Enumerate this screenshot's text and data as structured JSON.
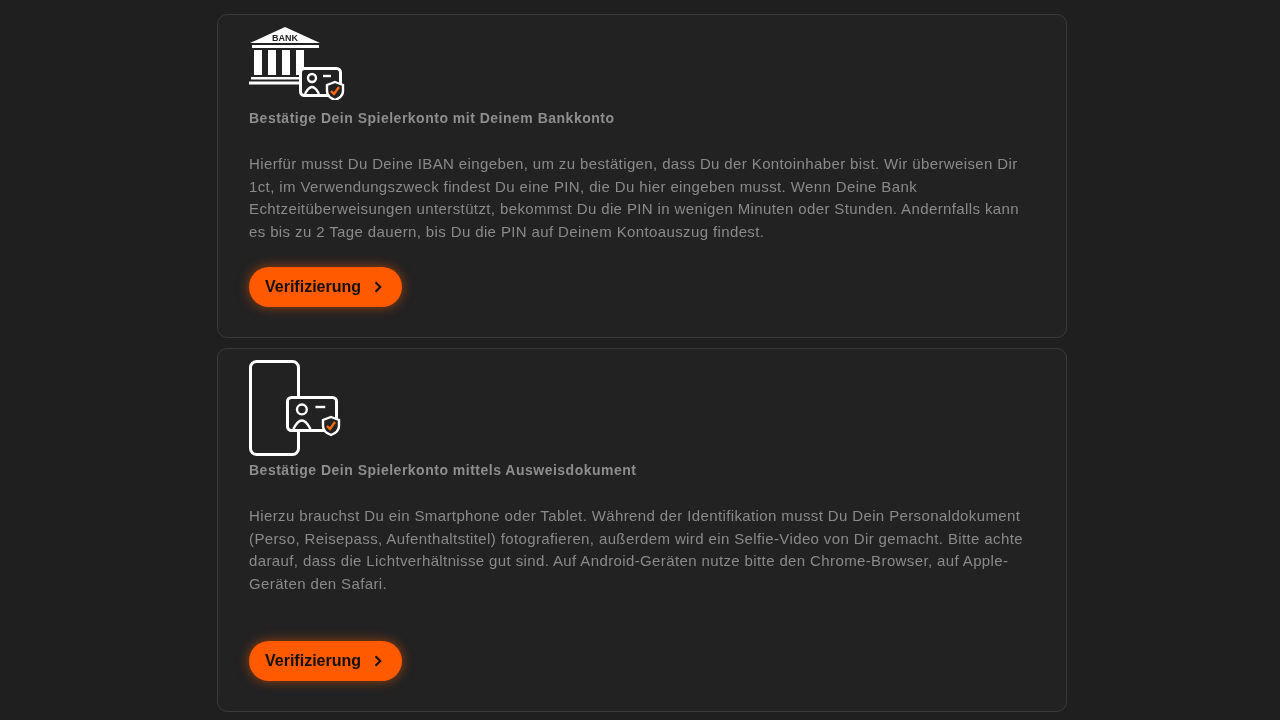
{
  "cards": [
    {
      "kind": "bank",
      "icon_label": "BANK",
      "title": "Bestätige Dein Spielerkonto mit Deinem Bankkonto",
      "description": "Hierfür musst Du Deine IBAN eingeben, um zu bestätigen, dass Du der Kontoinhaber bist. Wir überweisen Dir 1ct, im Verwendungszweck findest Du eine PIN, die Du hier eingeben musst. Wenn Deine Bank Echtzeitüberweisungen unterstützt, bekommst Du die PIN in wenigen Minuten oder Stunden. Andernfalls kann es bis zu 2 Tage dauern, bis Du die PIN auf Deinem Kontoauszug findest.",
      "button": {
        "label": "Verifizierung"
      }
    },
    {
      "kind": "phone",
      "title": "Bestätige Dein Spielerkonto mittels Ausweisdokument",
      "description": "Hierzu brauchst Du ein Smartphone oder Tablet. Während der Identifikation musst Du Dein Personaldokument (Perso, Reisepass, Aufenthaltstitel) fotografieren, außerdem wird ein Selfie-Video von Dir gemacht. Bitte achte darauf, dass die Lichtverhältnisse gut sind. Auf Android-Geräten nutze bitte den Chrome-Browser, auf Apple-Geräten den Safari.",
      "button": {
        "label": "Verifizierung"
      }
    }
  ]
}
